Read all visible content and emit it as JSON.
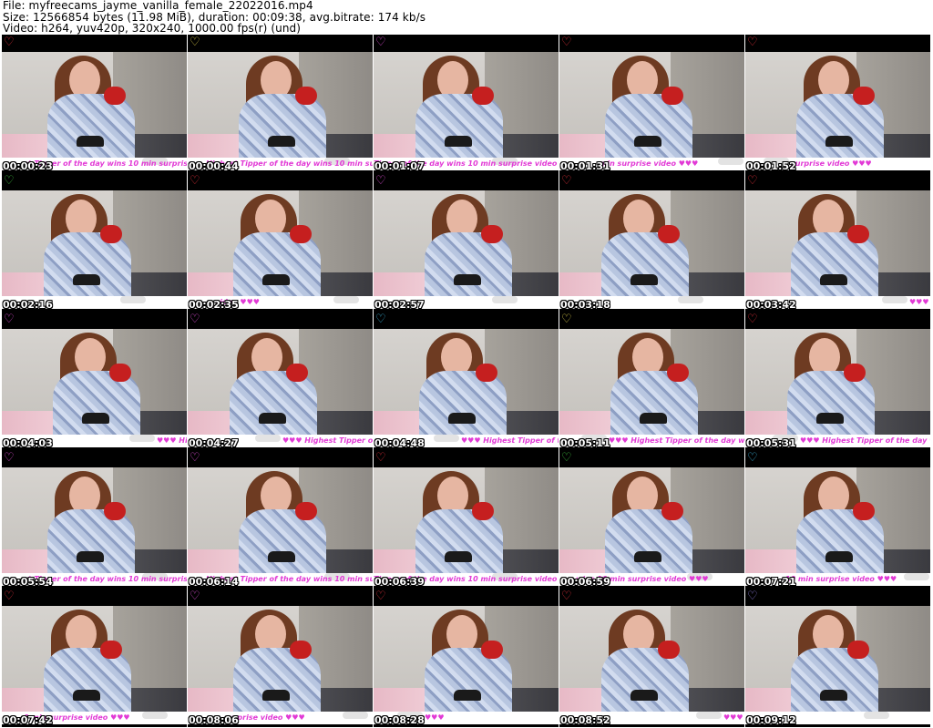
{
  "header": {
    "line1": "File: myfreecams_jayme_vanilla_female_22022016.mp4",
    "line2": "Size: 12566854 bytes (11.98 MiB), duration: 00:09:38, avg.bitrate: 174 kb/s",
    "line3": "Video: h264, yuv420p, 320x240, 1000.00 fps(r) (und)"
  },
  "ticker_text": "Highest Tipper of the day wins 10 min surprise video ♥♥♥",
  "thumbnails": [
    {
      "timestamp": "00:00:23",
      "heart_color": "#e0303a",
      "ticker": "st Tipper of the day wins 10 min surprise",
      "ticker_offset": 24
    },
    {
      "timestamp": "00:00:44",
      "heart_color": "#d6c84a",
      "ticker": "Highest Tipper of the day wins 10 min surpris",
      "ticker_offset": 20
    },
    {
      "timestamp": "00:01:07",
      "heart_color": "#e04fd8",
      "ticker": "Tipper of the day wins 10 min surprise video ♥♥♥",
      "ticker_offset": 0
    },
    {
      "timestamp": "00:01:31",
      "heart_color": "#e0303a",
      "ticker": "min surprise video ♥♥♥",
      "ticker_offset": 44
    },
    {
      "timestamp": "00:01:52",
      "heart_color": "#e0303a",
      "ticker": "surprise video ♥♥♥",
      "ticker_offset": 50
    },
    {
      "timestamp": "00:02:16",
      "heart_color": "#3fbf3f",
      "ticker": "",
      "ticker_offset": 0
    },
    {
      "timestamp": "00:02:35",
      "heart_color": "#e0303a",
      "ticker": "video ♥♥♥",
      "ticker_offset": 30
    },
    {
      "timestamp": "00:02:57",
      "heart_color": "#e04fd8",
      "ticker": "",
      "ticker_offset": 0
    },
    {
      "timestamp": "00:03:18",
      "heart_color": "#e0303a",
      "ticker": "",
      "ticker_offset": 0
    },
    {
      "timestamp": "00:03:42",
      "heart_color": "#e0303a",
      "ticker": "♥♥♥ H",
      "ticker_offset": 180
    },
    {
      "timestamp": "00:04:03",
      "heart_color": "#e04fd8",
      "ticker": "♥♥♥ Highest",
      "ticker_offset": 170
    },
    {
      "timestamp": "00:04:27",
      "heart_color": "#e04fd8",
      "ticker": "♥♥♥ Highest Tipper of th",
      "ticker_offset": 104
    },
    {
      "timestamp": "00:04:48",
      "heart_color": "#3ab0d8",
      "ticker": "♥♥♥ Highest Tipper of the d",
      "ticker_offset": 96
    },
    {
      "timestamp": "00:05:11",
      "heart_color": "#d6c84a",
      "ticker": "♥♥♥ Highest Tipper of the day wins 10 min",
      "ticker_offset": 54
    },
    {
      "timestamp": "00:05:31",
      "heart_color": "#e0303a",
      "ticker": "♥♥♥ Highest Tipper of the day wins",
      "ticker_offset": 60
    },
    {
      "timestamp": "00:05:54",
      "heart_color": "#e04fd8",
      "ticker": "st Tipper of the day wins 10 min surprise",
      "ticker_offset": 24
    },
    {
      "timestamp": "00:06:14",
      "heart_color": "#e04fd8",
      "ticker": "Highest Tipper of the day wins 10 min surpris",
      "ticker_offset": 20
    },
    {
      "timestamp": "00:06:39",
      "heart_color": "#e0303a",
      "ticker": "Tipper of the day wins 10 min surprise video ♥♥♥",
      "ticker_offset": 0
    },
    {
      "timestamp": "00:06:59",
      "heart_color": "#3fbf3f",
      "ticker": "y wins 10 min surprise video ♥♥♥",
      "ticker_offset": 10
    },
    {
      "timestamp": "00:07:21",
      "heart_color": "#3ab0d8",
      "ticker": "10 min surprise video ♥♥♥",
      "ticker_offset": 44
    },
    {
      "timestamp": "00:07:42",
      "heart_color": "#e0303a",
      "ticker": "0 min surprise video ♥♥♥",
      "ticker_offset": 24
    },
    {
      "timestamp": "00:08:06",
      "heart_color": "#e04fd8",
      "ticker": "surprise video ♥♥♥",
      "ticker_offset": 40
    },
    {
      "timestamp": "00:08:28",
      "heart_color": "#e0303a",
      "ticker": "♥♥♥",
      "ticker_offset": 56
    },
    {
      "timestamp": "00:08:52",
      "heart_color": "#e0303a",
      "ticker": "♥♥♥",
      "ticker_offset": 180
    },
    {
      "timestamp": "00:09:12",
      "heart_color": "#8a7ad8",
      "ticker": "",
      "ticker_offset": 0
    }
  ]
}
